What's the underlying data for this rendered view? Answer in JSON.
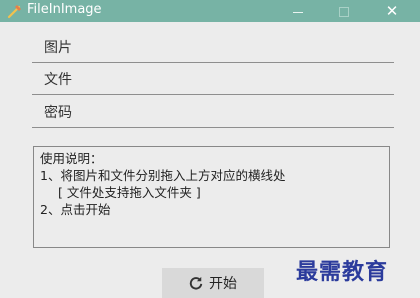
{
  "window": {
    "title": "FileInImage",
    "colors": {
      "titlebar": "#77b3a5",
      "body": "#ececec",
      "button": "#d9d9d9"
    },
    "controls": {
      "minimize_icon": "minimize-icon",
      "maximize_icon": "maximize-icon",
      "close_icon": "close-icon",
      "close_glyph": "✕"
    }
  },
  "fields": [
    {
      "label": "图片"
    },
    {
      "label": "文件"
    },
    {
      "label": "密码"
    }
  ],
  "instructions": {
    "lines": [
      "使用说明：",
      "1、将图片和文件分别拖入上方对应的横线处",
      "[ 文件处支持拖入文件夹 ]",
      "2、点击开始"
    ]
  },
  "start_button": {
    "label": "开始",
    "icon": "refresh-icon"
  },
  "watermark": {
    "text": "最需教育"
  }
}
